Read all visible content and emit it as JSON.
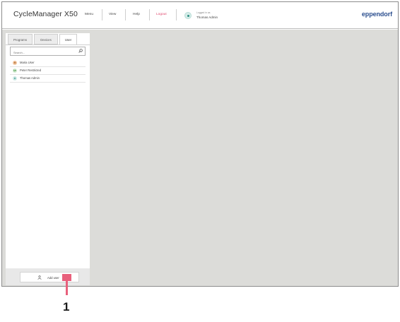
{
  "app": {
    "title": "CycleManager X50",
    "brand": "eppendorf"
  },
  "header": {
    "menu_items": [
      {
        "label": "Menu"
      },
      {
        "label": "View"
      },
      {
        "label": "Help"
      },
      {
        "label": "Logout"
      }
    ],
    "logged_in_label": "Logged in as",
    "logged_in_user": "Thomas Admin",
    "logout_color": "#e04a6f"
  },
  "tabs": [
    {
      "label": "Programs",
      "active": false
    },
    {
      "label": "Devices",
      "active": false
    },
    {
      "label": "User",
      "active": true
    }
  ],
  "search": {
    "placeholder": "Search..."
  },
  "users": [
    {
      "initials": "M",
      "name": "Maria User",
      "color": "#f3c7a1",
      "text_color": "#a05a1e"
    },
    {
      "initials": "Ur",
      "name": "Peter Restricted",
      "color": "#d3ecd2",
      "text_color": "#3a8a37"
    },
    {
      "initials": "A",
      "name": "Thomas Admin",
      "color": "#cfeae6",
      "text_color": "#2e8f82"
    }
  ],
  "footer": {
    "add_user_label": "Add user"
  },
  "callout": {
    "number": "1",
    "color": "#e8607c"
  }
}
